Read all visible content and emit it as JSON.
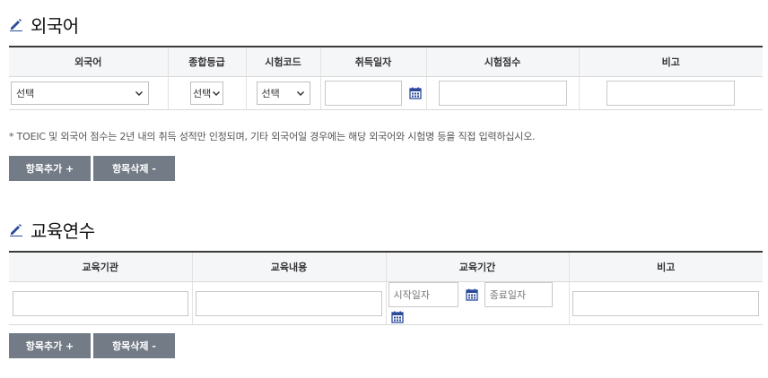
{
  "language": {
    "title": "외국어",
    "headers": [
      "외국어",
      "종합등급",
      "시험코드",
      "취득일자",
      "시험점수",
      "비고"
    ],
    "lang_select": "선택",
    "grade_select": "선택",
    "code_select": "선택",
    "note": "* TOEIC 및 외국어 점수는 2년 내의 취득 성적만 인정되며, 기타 외국어일 경우에는 해당 외국어와 시험명 등을 직접 입력하십시오.",
    "add_button": "항목추가 +",
    "delete_button": "항목삭제 -"
  },
  "training": {
    "title": "교육연수",
    "headers": [
      "교육기관",
      "교육내용",
      "교육기간",
      "비고"
    ],
    "start_placeholder": "시작일자",
    "end_placeholder": "종료일자",
    "add_button": "항목추가 +",
    "delete_button": "항목삭제 -"
  },
  "colors": {
    "button_bg": "#727b86",
    "calendar_icon": "#2b4a9a",
    "pencil_icon": "#2b4a9a"
  }
}
